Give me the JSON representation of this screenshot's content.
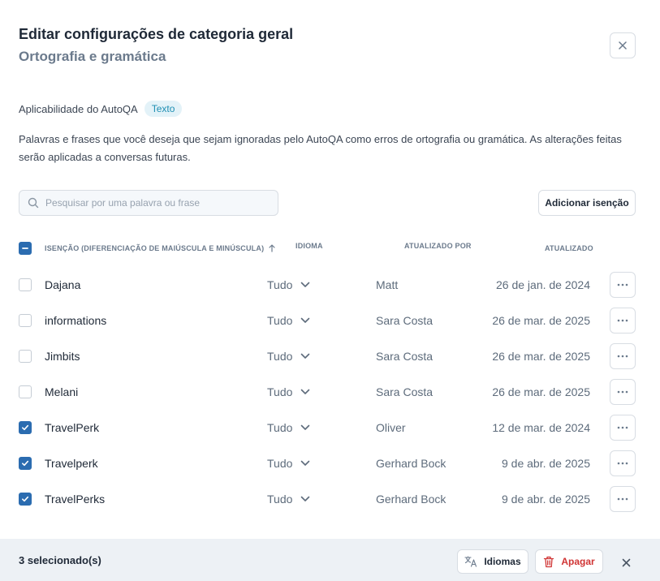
{
  "dialog": {
    "title": "Editar configurações de categoria geral",
    "subtitle": "Ortografia e gramática"
  },
  "applicability": {
    "label": "Aplicabilidade do AutoQA",
    "tag": "Texto"
  },
  "description": "Palavras e frases que você deseja que sejam ignoradas pelo AutoQA como erros de ortografia ou gramática. As alterações feitas serão aplicadas a conversas futuras.",
  "search": {
    "placeholder": "Pesquisar por uma palavra ou frase",
    "value": ""
  },
  "add_button": "Adicionar isenção",
  "table": {
    "headers": {
      "exemption": "Isenção (diferenciação de maiúscula e minúscula)",
      "language": "Idioma",
      "updated_by": "Atualizado por",
      "updated": "Atualizado"
    },
    "rows": [
      {
        "name": "Dajana",
        "language": "Tudo",
        "updated_by": "Matt",
        "updated": "26 de jan. de 2024",
        "checked": false
      },
      {
        "name": "informations",
        "language": "Tudo",
        "updated_by": "Sara Costa",
        "updated": "26 de mar. de 2025",
        "checked": false
      },
      {
        "name": "Jimbits",
        "language": "Tudo",
        "updated_by": "Sara Costa",
        "updated": "26 de mar. de 2025",
        "checked": false
      },
      {
        "name": "Melani",
        "language": "Tudo",
        "updated_by": "Sara Costa",
        "updated": "26 de mar. de 2025",
        "checked": false
      },
      {
        "name": "TravelPerk",
        "language": "Tudo",
        "updated_by": "Oliver",
        "updated": "12 de mar. de 2024",
        "checked": true
      },
      {
        "name": "Travelperk",
        "language": "Tudo",
        "updated_by": "Gerhard Bock",
        "updated": "9 de abr. de 2025",
        "checked": true
      },
      {
        "name": "TravelPerks",
        "language": "Tudo",
        "updated_by": "Gerhard Bock",
        "updated": "9 de abr. de 2025",
        "checked": true
      }
    ]
  },
  "footer": {
    "selected_count": "3 selecionado(s)",
    "languages_button": "Idiomas",
    "delete_button": "Apagar"
  },
  "colors": {
    "accent": "#2b6cb0",
    "danger": "#d03434",
    "tag_bg": "#e3f2f8",
    "tag_text": "#1f8fb3"
  }
}
